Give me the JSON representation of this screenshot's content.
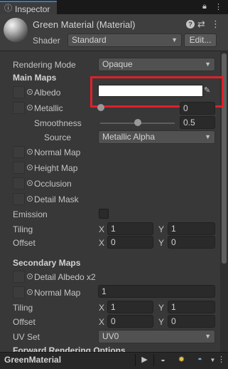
{
  "tab": {
    "title": "Inspector"
  },
  "header": {
    "material_title": "Green Material (Material)",
    "shader_label": "Shader",
    "shader_value": "Standard",
    "edit_button": "Edit..."
  },
  "props": {
    "rendering_mode_label": "Rendering Mode",
    "rendering_mode_value": "Opaque",
    "main_maps": "Main Maps",
    "albedo": "Albedo",
    "albedo_color": "#ffffff",
    "metallic": "Metallic",
    "metallic_value": "0",
    "smoothness": "Smoothness",
    "smoothness_value": "0.5",
    "smoothness_level": 0.5,
    "source": "Source",
    "source_value": "Metallic Alpha",
    "normal_map": "Normal Map",
    "height_map": "Height Map",
    "occlusion": "Occlusion",
    "detail_mask": "Detail Mask",
    "emission": "Emission",
    "tiling": "Tiling",
    "offset": "Offset",
    "x": "X",
    "y": "Y",
    "tiling_x": "1",
    "tiling_y": "1",
    "offset_x": "0",
    "offset_y": "0",
    "secondary_maps": "Secondary Maps",
    "detail_albedo": "Detail Albedo x2",
    "sec_normal_map": "Normal Map",
    "sec_normal_value": "1",
    "sec_tiling_x": "1",
    "sec_tiling_y": "1",
    "sec_offset_x": "0",
    "sec_offset_y": "0",
    "uv_set": "UV Set",
    "uv_set_value": "UV0",
    "forward_rendering": "Forward Rendering Options"
  },
  "preview": {
    "title": "GreenMaterial"
  },
  "icons": {
    "tab": "inspector-icon",
    "lock": "lock-icon",
    "menu": "menu-icon",
    "help": "help-icon",
    "settings": "settings-icon",
    "more": "more-icon",
    "eyedropper": "eyedropper-icon",
    "play": "play-icon",
    "sphere": "sphere-preview-icon",
    "lights": "lights-icon",
    "sky": "skybox-icon"
  },
  "colors": {
    "highlight": "#e0202a",
    "accent": "#3a79bb"
  }
}
